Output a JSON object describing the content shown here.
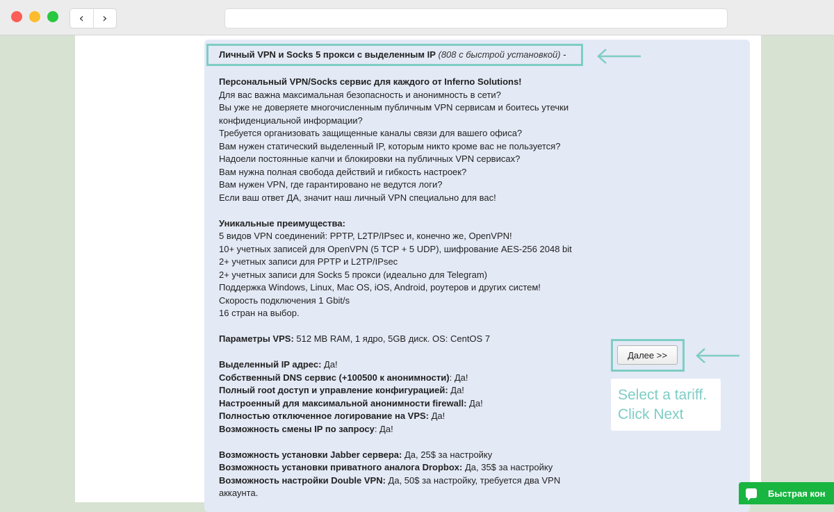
{
  "browser": {
    "back_glyph": "‹",
    "forward_glyph": "›",
    "url": ""
  },
  "title": {
    "main": "Личный VPN и Socks 5 прокси с выделенным IP",
    "sub": "(808 с быстрой установкой)",
    "suffix": " -"
  },
  "intro": {
    "heading": "Персональный VPN/Socks сервис для каждого от Inferno Solutions!",
    "lines": [
      "Для вас важна максимальная безопасность и анонимность в сети?",
      "Вы уже не доверяете многочисленным публичным VPN сервисам и боитесь утечки конфиденциальной информации?",
      "Требуется организовать защищенные каналы связи для вашего офиса?",
      "Вам нужен статический выделенный IP, которым никто кроме вас не пользуется?",
      "Надоели постоянные капчи и блокировки на публичных VPN сервисах?",
      "Вам нужна полная свобода действий и гибкость настроек?",
      "Вам нужен VPN, где гарантировано не ведутся логи?",
      "Если ваш ответ ДА, значит наш личный VPN специально для вас!"
    ]
  },
  "advantages": {
    "heading": "Уникальные преимущества:",
    "lines": [
      "5 видов VPN соединений: PPTP, L2TP/IPsec и, конечно же, OpenVPN!",
      "10+ учетных записей для OpenVPN (5 TCP + 5 UDP), шифрование AES-256 2048 bit",
      "2+ учетных записи для PPTP и L2TP/IPsec",
      "2+ учетных записи для Socks 5 прокси (идеально для Telegram)",
      "Поддержка Windows, Linux, Mac OS, iOS, Android, роутеров и других систем!",
      "Скорость подключения 1 Gbit/s",
      "16 стран на выбор."
    ]
  },
  "vps": {
    "label": "Параметры VPS:",
    "value": " 512 MB RAM, 1 ядро, 5GB диск. OS: CentOS 7"
  },
  "features": [
    {
      "label": "Выделенный IP адрес:",
      "value": " Да!"
    },
    {
      "label": "Собственный DNS сервис (+100500 к анонимности)",
      "value": ": Да!"
    },
    {
      "label": "Полный root доступ и управление конфигурацией:",
      "value": " Да!"
    },
    {
      "label": "Настроенный для максимальной анонимности firewall:",
      "value": " Да!"
    },
    {
      "label": "Полностью отключенное логирование на VPS:",
      "value": " Да!"
    },
    {
      "label": "Возможность смены IP по запросу",
      "value": ": Да!"
    }
  ],
  "extras": [
    {
      "label": "Возможность установки Jabber сервера:",
      "value": " Да, 25$ за настройку"
    },
    {
      "label": "Возможность установки приватного аналога Dropbox:",
      "value": " Да, 35$ за настройку"
    },
    {
      "label": "Возможность настройки Double VPN:",
      "value": " Да, 50$ за настройку, требуется два VPN аккаунта."
    }
  ],
  "next_button": "Далее >>",
  "hint": {
    "line1": "Select a tariff.",
    "line2": "Click Next"
  },
  "quick_button": "Быстрая кон",
  "colors": {
    "accent": "#7ecdc4",
    "card": "#e3e9f5",
    "quick": "#18b541"
  }
}
